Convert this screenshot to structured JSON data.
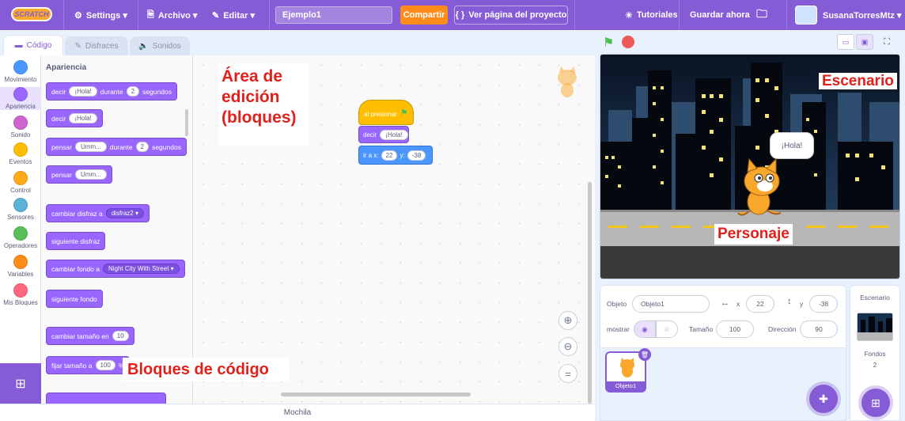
{
  "menubar": {
    "logo": "SCRATCH",
    "settings": "Settings ▾",
    "file": "Archivo ▾",
    "edit": "Editar ▾",
    "project_title": "Ejemplo1",
    "share": "Compartir",
    "project_page": "Ver página del proyecto",
    "tutorials": "Tutoriales",
    "save_now": "Guardar ahora",
    "username": "SusanaTorresMtz ▾"
  },
  "tabs": {
    "code": "Código",
    "costumes": "Disfraces",
    "sounds": "Sonidos"
  },
  "categories": [
    {
      "label": "Movimiento",
      "color": "#4c97ff"
    },
    {
      "label": "Apariencia",
      "color": "#9966ff"
    },
    {
      "label": "Sonido",
      "color": "#cf63cf"
    },
    {
      "label": "Eventos",
      "color": "#ffbf00"
    },
    {
      "label": "Control",
      "color": "#ffab19"
    },
    {
      "label": "Sensores",
      "color": "#5cb1d6"
    },
    {
      "label": "Operadores",
      "color": "#59c059"
    },
    {
      "label": "Variables",
      "color": "#ff8c1a"
    },
    {
      "label": "Mis Bloques",
      "color": "#ff6680"
    }
  ],
  "palette": {
    "heading": "Apariencia",
    "b1": {
      "t1": "decir",
      "p1": "¡Hola!",
      "t2": "durante",
      "p2": "2",
      "t3": "segundos"
    },
    "b2": {
      "t1": "decir",
      "p1": "¡Hola!"
    },
    "b3": {
      "t1": "pensar",
      "p1": "Umm...",
      "t2": "durante",
      "p2": "2",
      "t3": "segundos"
    },
    "b4": {
      "t1": "pensar",
      "p1": "Umm..."
    },
    "b5": {
      "t1": "cambiar disfraz a",
      "p1": "disfraz2 ▾"
    },
    "b6": {
      "t1": "siguiente disfraz"
    },
    "b7": {
      "t1": "cambiar fondo a",
      "p1": "Night City With Street ▾"
    },
    "b8": {
      "t1": "siguiente fondo"
    },
    "b9": {
      "t1": "cambiar tamaño en",
      "p1": "10"
    },
    "b10": {
      "t1": "fijar tamaño a",
      "p1": "100",
      "t2": "%"
    }
  },
  "script": {
    "hat": "al presionar",
    "say": "decir",
    "say_value": "¡Hola!",
    "goto": "ir a x:",
    "x": "22",
    "y_label": "y:",
    "y": "-38"
  },
  "annotations": {
    "edit_area_l1": "Área de",
    "edit_area_l2": "edición",
    "edit_area_l3": "(bloques)",
    "code_blocks": "Bloques de código",
    "stage": "Escenario",
    "character": "Personaje"
  },
  "stage": {
    "speech": "¡Hola!"
  },
  "sprite_info": {
    "sprite_label": "Objeto",
    "sprite_name": "Objeto1",
    "x_label": "x",
    "x": "22",
    "y_label": "y",
    "y": "-38",
    "show_label": "mostrar",
    "size_label": "Tamaño",
    "size": "100",
    "direction_label": "Dirección",
    "direction": "90"
  },
  "sprite_list": {
    "sprite1": "Objeto1"
  },
  "stage_panel": {
    "title": "Escenario",
    "backdrops_label": "Fondos",
    "backdrops_count": "2"
  },
  "backpack": "Mochila"
}
